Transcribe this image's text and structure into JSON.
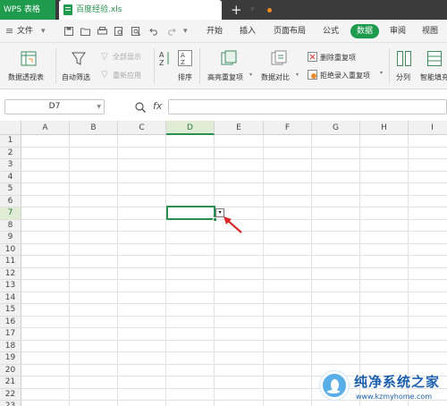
{
  "titlebar": {
    "app_tab": "WPS 表格",
    "doc_tab": "百度经验.xls",
    "tab_menu": "▾",
    "new_tab": "+"
  },
  "menubar": {
    "hamburger": "≡",
    "file": "文件",
    "file_arrow": "▾",
    "quick_icons": [
      "save-icon",
      "folder-icon",
      "print-icon",
      "print-preview-icon",
      "find-icon",
      "undo-icon",
      "redo-icon"
    ],
    "more_arrow": "▾",
    "items": [
      "开始",
      "插入",
      "页面布局",
      "公式",
      "数据",
      "审阅",
      "视图"
    ],
    "active": "数据"
  },
  "ribbon": {
    "pivot": "数据透视表",
    "autofilter": "自动筛选",
    "show_all": "全部显示",
    "reapply": "重新应用",
    "sort": "排序",
    "highlight_dup": "高亮重复项",
    "highlight_arrow": "▾",
    "compare": "数据对比",
    "compare_arrow": "▾",
    "remove_dup": "删除重复项",
    "reject_dup": "拒绝录入重复项",
    "reject_arrow": "▾",
    "split": "分列",
    "smart_fill": "智能填充"
  },
  "formula": {
    "cell_ref": "D7",
    "fx": "fx",
    "value": ""
  },
  "sheet": {
    "columns": [
      "A",
      "B",
      "C",
      "D",
      "E",
      "F",
      "G",
      "H",
      "I"
    ],
    "rows": [
      "1",
      "2",
      "3",
      "4",
      "5",
      "6",
      "7",
      "8",
      "9",
      "10",
      "11",
      "12",
      "13",
      "14",
      "15",
      "16",
      "17",
      "18",
      "19",
      "20",
      "21",
      "22",
      "23"
    ],
    "selected_col": "D",
    "selected_row": "7",
    "dropdown_glyph": "▾"
  },
  "watermark": {
    "title": "纯净系统之家",
    "url": "www.kzmyhome.com"
  },
  "colors": {
    "accent": "#1f9b4e",
    "titlebar": "#3b3b3b",
    "arrow": "#d62b2b"
  }
}
